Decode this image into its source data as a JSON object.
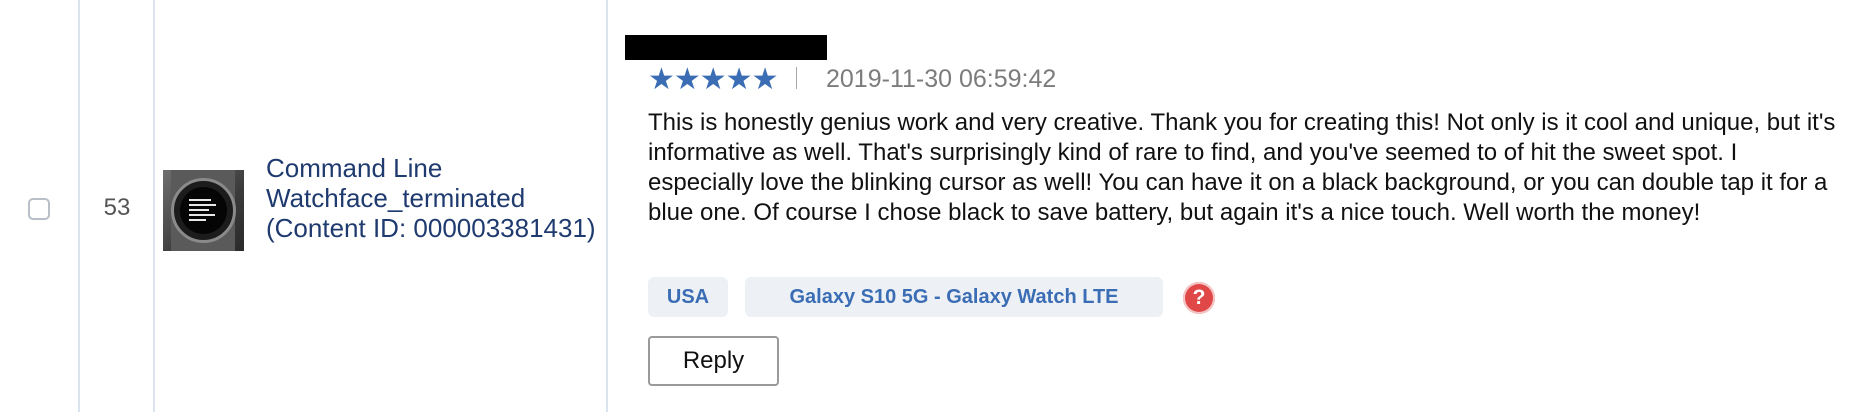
{
  "row": {
    "number": "53",
    "product": {
      "name": "Command Line Watchface_terminated (Content ID: 000003381431)"
    }
  },
  "review": {
    "rating": 5,
    "stars": "★★★★★",
    "separator": "|",
    "date": "2019-11-30 06:59:42",
    "text": "This is honestly genius work and very creative. Thank you for creating this! Not only is it cool and unique, but it's informative as well. That's surprisingly kind of rare to find, and you've seemed to of hit the sweet spot. I especially love the blinking cursor as well! You can have it on a black background, or you can double tap it for a blue one. Of course I chose black to save battery, but again it's a nice touch. Well worth the money!",
    "tags": {
      "country": "USA",
      "device": "Galaxy S10 5G - Galaxy Watch LTE"
    },
    "help_icon": "?",
    "reply_label": "Reply"
  },
  "colors": {
    "accent": "#3b6db5",
    "product_link": "#1f3a6e",
    "tag_bg": "#edf1f6",
    "help_icon": "#e04848",
    "divider": "#dbe3ee"
  },
  "icons": {
    "checkbox": "checkbox-icon",
    "help": "question-mark-icon",
    "thumbnail": "watchface-thumbnail"
  }
}
